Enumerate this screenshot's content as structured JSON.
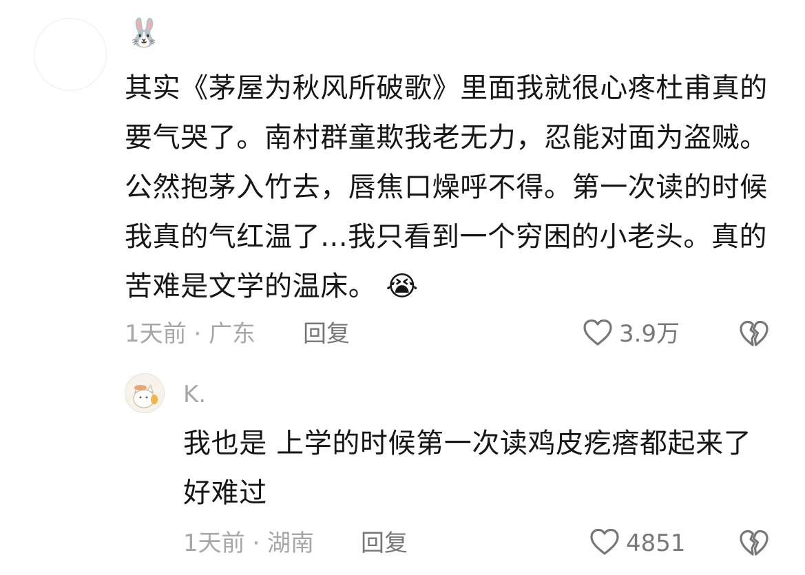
{
  "comment": {
    "username_emoji": "🐰",
    "text": "其实《茅屋为秋风所破歌》里面我就很心疼杜甫真的要气哭了。南村群童欺我老无力，忍能对面为盗贼。公然抱茅入竹去，唇焦口燥呼不得。第一次读的时候我真的气红温了...我只看到一个穷困的小老头。真的苦难是文学的温床。",
    "emoji": "😭",
    "time_location": "1天前 · 广东",
    "reply_label": "回复",
    "like_count": "3.9万"
  },
  "reply": {
    "username": "K.",
    "text": "我也是 上学的时候第一次读鸡皮疙瘩都起来了 好难过",
    "time_location": "1天前 · 湖南",
    "reply_label": "回复",
    "like_count": "4851"
  },
  "colors": {
    "text": "#161616",
    "meta": "#a7a7a7",
    "action": "#777777"
  },
  "icons": {
    "like": "heart-outline-icon",
    "dislike": "broken-heart-icon"
  }
}
